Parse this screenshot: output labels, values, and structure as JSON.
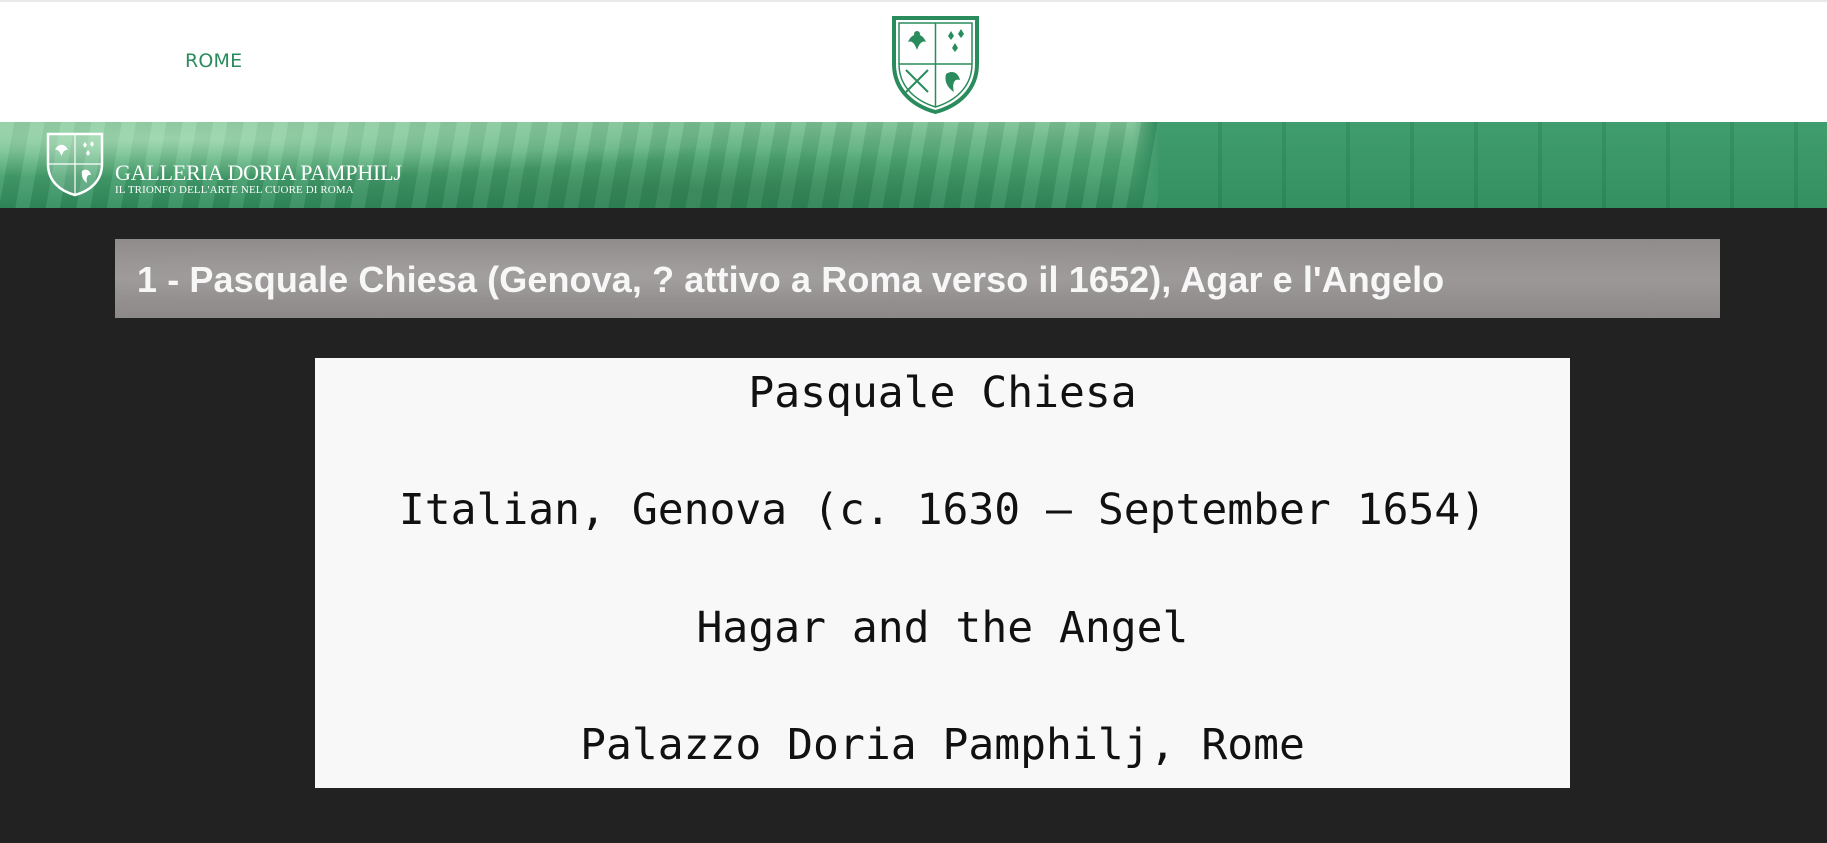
{
  "nav": {
    "link_label": "ROME"
  },
  "banner": {
    "title": "GALLERIA DORIA PAMPHILJ",
    "subtitle": "IL TRIONFO DELL'ARTE NEL CUORE DI ROMA"
  },
  "caption": {
    "text": "1  - Pasquale Chiesa (Genova, ? attivo a Roma verso il 1652), Agar e l'Angelo"
  },
  "artwork": {
    "artist": "Pasquale Chiesa",
    "details": "Italian, Genova (c. 1630 – September 1654)",
    "title": "Hagar and the Angel",
    "location": "Palazzo Doria Pamphilj, Rome"
  },
  "colors": {
    "brand_green": "#2a8c5c",
    "background": "#222223",
    "card": "#f8f8f8"
  },
  "icons": {
    "crest": "crest-icon"
  }
}
